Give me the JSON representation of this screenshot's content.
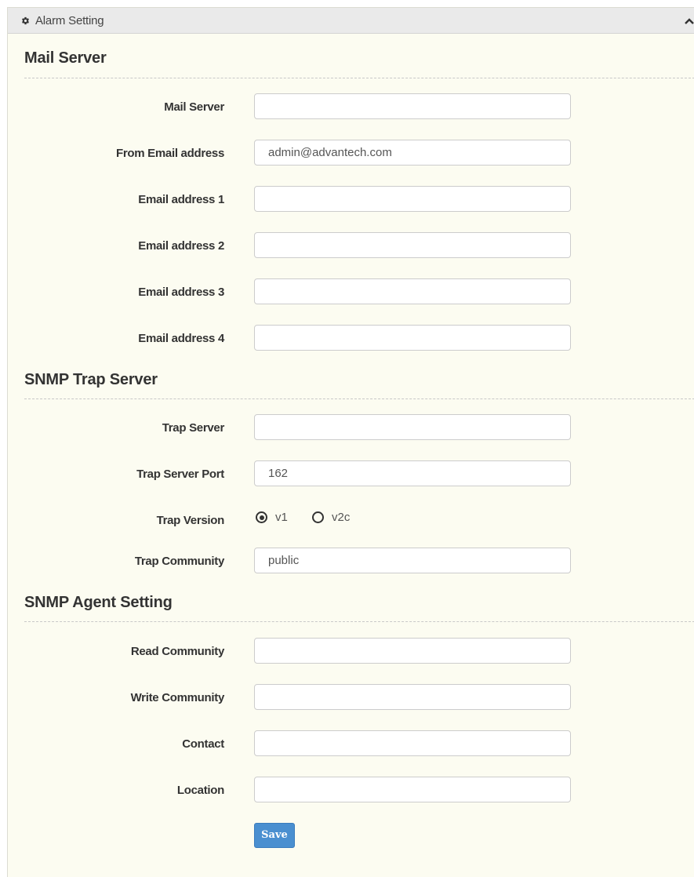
{
  "panel": {
    "title": "Alarm Setting",
    "header_icon": "gear-icon",
    "collapse_icon": "chevron-up-icon"
  },
  "mail_server": {
    "section_title": "Mail Server",
    "mail_server_label": "Mail Server",
    "mail_server_value": "",
    "from_email_label": "From Email address",
    "from_email_value": "admin@advantech.com",
    "email1_label": "Email address 1",
    "email1_value": "",
    "email2_label": "Email address 2",
    "email2_value": "",
    "email3_label": "Email address 3",
    "email3_value": "",
    "email4_label": "Email address 4",
    "email4_value": ""
  },
  "snmp_trap": {
    "section_title": "SNMP Trap Server",
    "trap_server_label": "Trap Server",
    "trap_server_value": "",
    "trap_port_label": "Trap Server Port",
    "trap_port_value": "162",
    "trap_version_label": "Trap Version",
    "version_options": [
      "v1",
      "v2c"
    ],
    "version_selected": "v1",
    "trap_community_label": "Trap Community",
    "trap_community_value": "public"
  },
  "snmp_agent": {
    "section_title": "SNMP Agent Setting",
    "read_community_label": "Read Community",
    "read_community_value": "",
    "write_community_label": "Write Community",
    "write_community_value": "",
    "contact_label": "Contact",
    "contact_value": "",
    "location_label": "Location",
    "location_value": ""
  },
  "actions": {
    "save_label": "Save"
  },
  "colors": {
    "panel_background": "#fcfcf1",
    "header_background": "#eaeaea",
    "save_button": "#4a8fd0"
  }
}
